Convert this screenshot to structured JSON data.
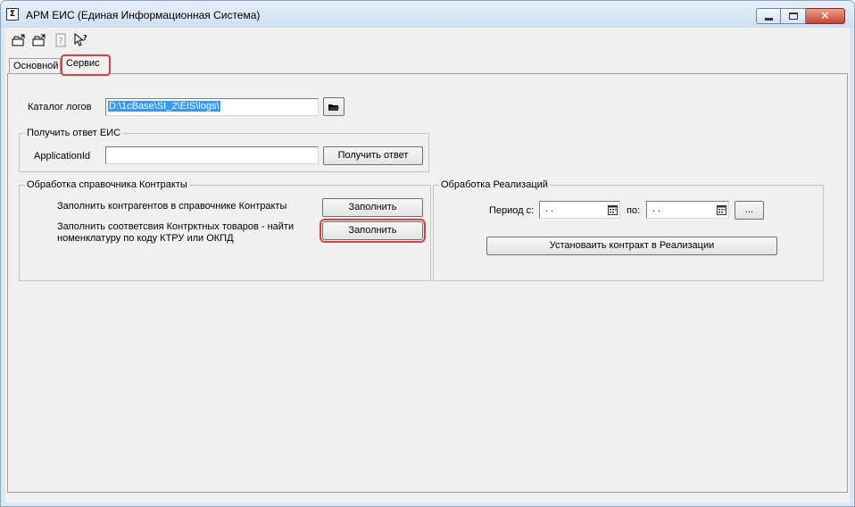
{
  "window": {
    "icon_glyph": "Σ",
    "title": "АРМ ЕИС (Единая Информационная Система)"
  },
  "toolbar": {
    "icons": [
      "open-folder-icon",
      "save-icon",
      "help-icon",
      "pointer-help-icon"
    ]
  },
  "tabs": [
    {
      "label": "Основной",
      "active": false
    },
    {
      "label": "Сервис",
      "active": true
    }
  ],
  "logs": {
    "label": "Каталог логов",
    "value": "D:\\1cBase\\SI_2\\EIS\\logs\\"
  },
  "eis_response": {
    "group_title": "Получить ответ ЕИС",
    "app_id_label": "ApplicationId",
    "app_id_value": "",
    "button_label": "Получить ответ"
  },
  "contracts": {
    "group_title": "Обработка справочника Контракты",
    "row1_text": "Заполнить контрагентов в справочнике Контракты",
    "row1_button": "Заполнить",
    "row2_text": "Заполнить соответсвия Контрктных товаров - найти номенклатуру по коду КТРУ или ОКПД",
    "row2_button": "Заполнить"
  },
  "sales": {
    "group_title": "Обработка Реализаций",
    "period_from_label": "Период с:",
    "period_from_value": ". .",
    "period_to_label": "по:",
    "period_to_value": ". .",
    "ellipsis_label": "...",
    "set_contract_button": "Установаить контракт в Реализации"
  },
  "colors": {
    "highlight": "#d94040",
    "selection": "#3399ff"
  }
}
